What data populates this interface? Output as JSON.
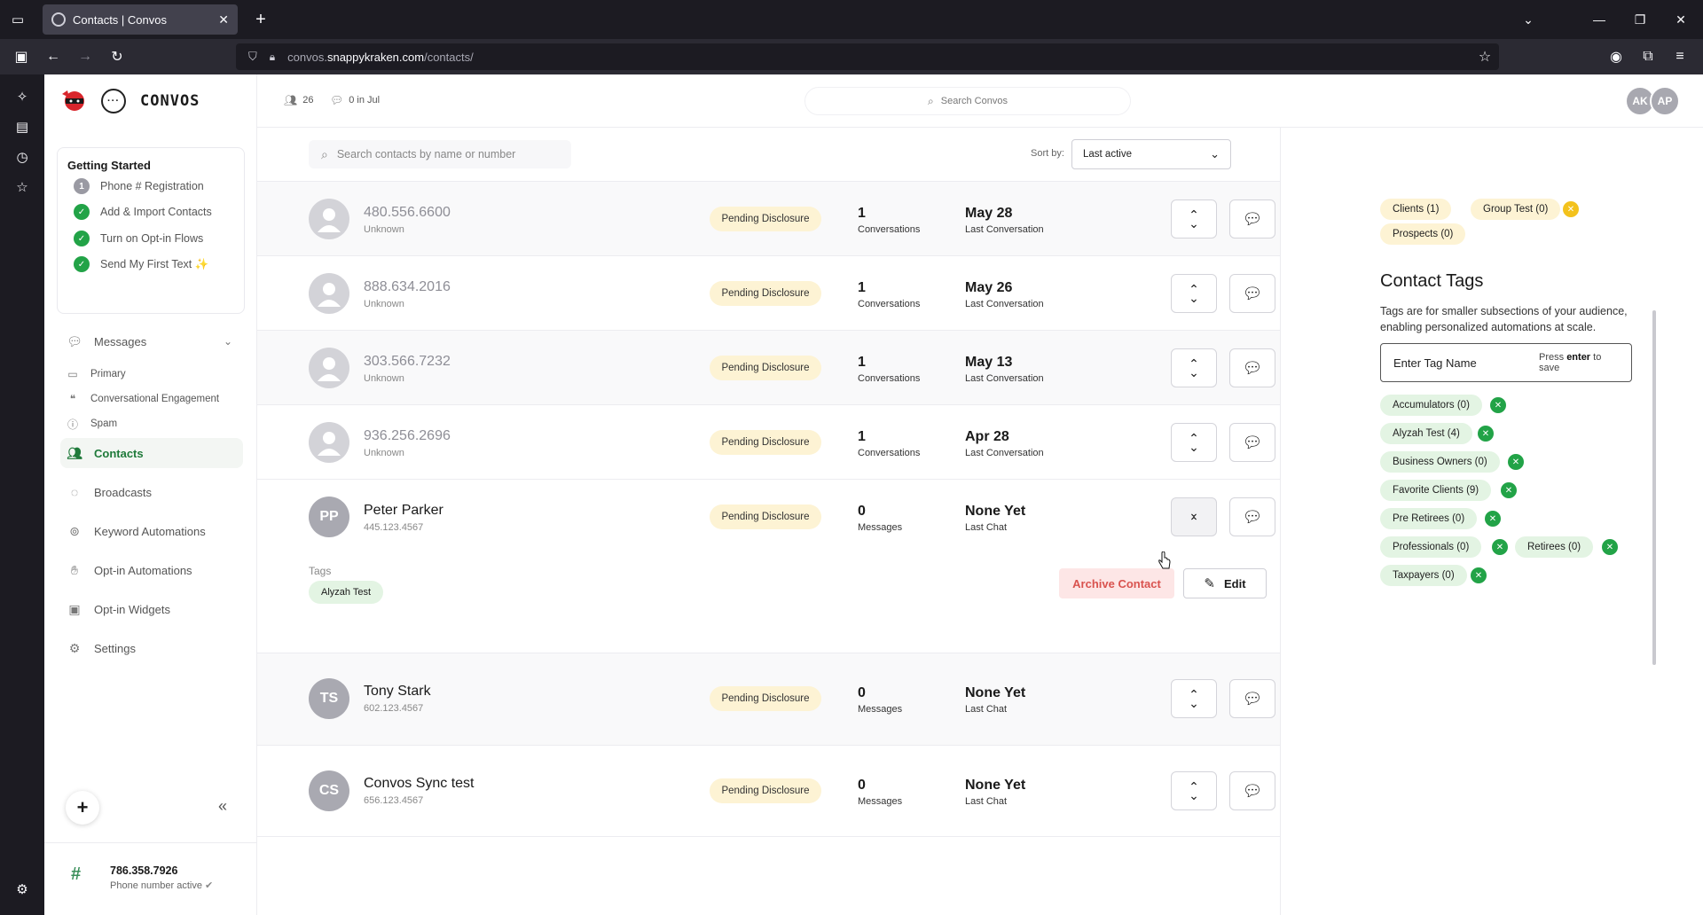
{
  "browser": {
    "tab_title": "Contacts | Convos",
    "url_prefix": "convos.",
    "url_domain": "snappykraken.com",
    "url_path": "/contacts/"
  },
  "app": {
    "brand": "CONVOS",
    "getting_started": {
      "title": "Getting Started",
      "items": [
        {
          "marker": "1",
          "label": "Phone # Registration",
          "done": false
        },
        {
          "marker": "✓",
          "label": "Add & Import Contacts",
          "done": true
        },
        {
          "marker": "✓",
          "label": "Turn on Opt-in Flows",
          "done": true
        },
        {
          "marker": "✓",
          "label": "Send My First Text ✨",
          "done": true
        }
      ]
    },
    "menu": {
      "messages": "Messages",
      "primary": "Primary",
      "conversational": "Conversational Engagement",
      "spam": "Spam",
      "contacts": "Contacts",
      "broadcasts": "Broadcasts",
      "keyword": "Keyword Automations",
      "optin_auto": "Opt-in Automations",
      "optin_widgets": "Opt-in Widgets",
      "settings": "Settings"
    },
    "phone": {
      "number": "786.358.7926",
      "status": "Phone number active"
    }
  },
  "topbar": {
    "contacts_count": "26",
    "messages_stat": "0 in Jul",
    "search_placeholder": "Search Convos",
    "avatars": [
      "AK",
      "AP"
    ]
  },
  "list": {
    "search_placeholder": "Search contacts by name or number",
    "sort_label": "Sort by:",
    "sort_value": "Last active",
    "rows": [
      {
        "name": "480.556.6600",
        "sub": "Unknown",
        "status": "Pending Disclosure",
        "count": "1",
        "count_label": "Conversations",
        "date": "May 28",
        "date_label": "Last Conversation"
      },
      {
        "name": "888.634.2016",
        "sub": "Unknown",
        "status": "Pending Disclosure",
        "count": "1",
        "count_label": "Conversations",
        "date": "May 26",
        "date_label": "Last Conversation"
      },
      {
        "name": "303.566.7232",
        "sub": "Unknown",
        "status": "Pending Disclosure",
        "count": "1",
        "count_label": "Conversations",
        "date": "May 13",
        "date_label": "Last Conversation"
      },
      {
        "name": "936.256.2696",
        "sub": "Unknown",
        "status": "Pending Disclosure",
        "count": "1",
        "count_label": "Conversations",
        "date": "Apr 28",
        "date_label": "Last Conversation"
      },
      {
        "initials": "PP",
        "name": "Peter Parker",
        "sub": "445.123.4567",
        "status": "Pending Disclosure",
        "count": "0",
        "count_label": "Messages",
        "date": "None Yet",
        "date_label": "Last Chat",
        "tags_label": "Tags",
        "tags": [
          "Alyzah Test"
        ],
        "archive_label": "Archive Contact",
        "edit_label": "Edit"
      },
      {
        "initials": "TS",
        "name": "Tony Stark",
        "sub": "602.123.4567",
        "status": "Pending Disclosure",
        "count": "0",
        "count_label": "Messages",
        "date": "None Yet",
        "date_label": "Last Chat"
      },
      {
        "initials": "CS",
        "name": "Convos Sync test",
        "sub": "656.123.4567",
        "status": "Pending Disclosure",
        "count": "0",
        "count_label": "Messages",
        "date": "None Yet",
        "date_label": "Last Chat"
      }
    ]
  },
  "right": {
    "groups": [
      "Clients (1)",
      "Group Test (0)",
      "Prospects (0)"
    ],
    "contact_tags_title": "Contact Tags",
    "contact_tags_desc": "Tags are for smaller subsections of your audience, enabling personalized automations at scale.",
    "tag_input_placeholder": "Enter Tag Name",
    "tag_hint_pre": "Press ",
    "tag_hint_key": "enter",
    "tag_hint_post": " to save",
    "tags": [
      "Accumulators (0)",
      "Alyzah Test (4)",
      "Business Owners (0)",
      "Favorite Clients (9)",
      "Pre Retirees (0)",
      "Professionals (0)",
      "Retirees (0)",
      "Taxpayers (0)"
    ]
  }
}
